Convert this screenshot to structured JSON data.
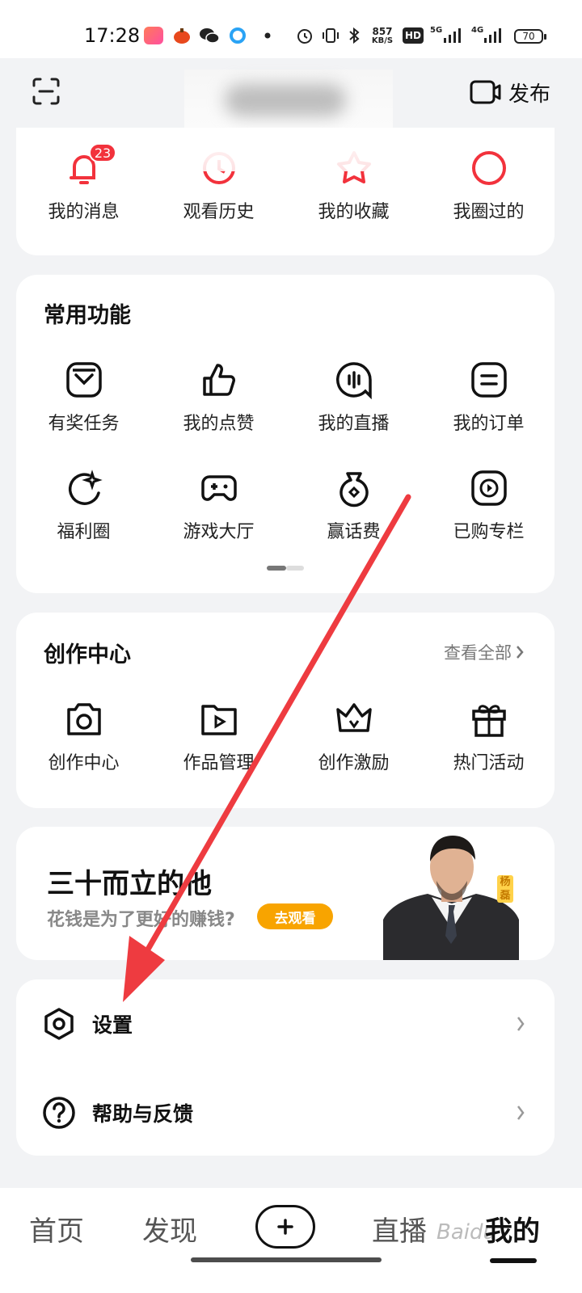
{
  "status_bar": {
    "time": "17:28",
    "net_speed_value": "857",
    "net_speed_unit": "KB/S",
    "hd_label": "HD",
    "signal1_label": "5G",
    "signal2_label": "4G",
    "battery": "70"
  },
  "header": {
    "publish_label": "发布",
    "scan_icon": "scan-icon",
    "camera_icon": "video-camera-icon"
  },
  "quick_items": [
    {
      "label": "我的消息",
      "icon": "bell-icon",
      "badge": "23"
    },
    {
      "label": "观看历史",
      "icon": "history-icon"
    },
    {
      "label": "我的收藏",
      "icon": "star-icon"
    },
    {
      "label": "我圈过的",
      "icon": "circle-icon"
    }
  ],
  "common": {
    "title": "常用功能",
    "items": [
      {
        "label": "有奖任务",
        "icon": "reward-icon"
      },
      {
        "label": "我的点赞",
        "icon": "thumb-up-icon"
      },
      {
        "label": "我的直播",
        "icon": "live-icon"
      },
      {
        "label": "我的订单",
        "icon": "order-icon"
      },
      {
        "label": "福利圈",
        "icon": "moon-star-icon"
      },
      {
        "label": "游戏大厅",
        "icon": "gamepad-icon"
      },
      {
        "label": "赢话费",
        "icon": "money-bag-icon"
      },
      {
        "label": "已购专栏",
        "icon": "play-square-icon"
      }
    ]
  },
  "creation": {
    "title": "创作中心",
    "see_all": "查看全部",
    "items": [
      {
        "label": "创作中心",
        "icon": "camera-icon"
      },
      {
        "label": "作品管理",
        "icon": "video-folder-icon"
      },
      {
        "label": "创作激励",
        "icon": "crown-icon"
      },
      {
        "label": "热门活动",
        "icon": "gift-icon"
      }
    ]
  },
  "banner": {
    "title": "三十而立的他",
    "subtitle": "花钱是为了更好的赚钱?",
    "button": "去观看",
    "name_tag": "杨磊"
  },
  "settings_list": [
    {
      "label": "设置",
      "icon": "settings-hexagon-icon"
    },
    {
      "label": "帮助与反馈",
      "icon": "help-icon"
    }
  ],
  "bottom_nav": [
    {
      "label": "首页"
    },
    {
      "label": "发现"
    },
    {
      "label": "直播"
    },
    {
      "label": "我的"
    }
  ],
  "watermark": "Baidu",
  "colors": {
    "accent_red": "#f2323c",
    "button_orange": "#f8a400",
    "annotation_red": "#ee3b40"
  }
}
